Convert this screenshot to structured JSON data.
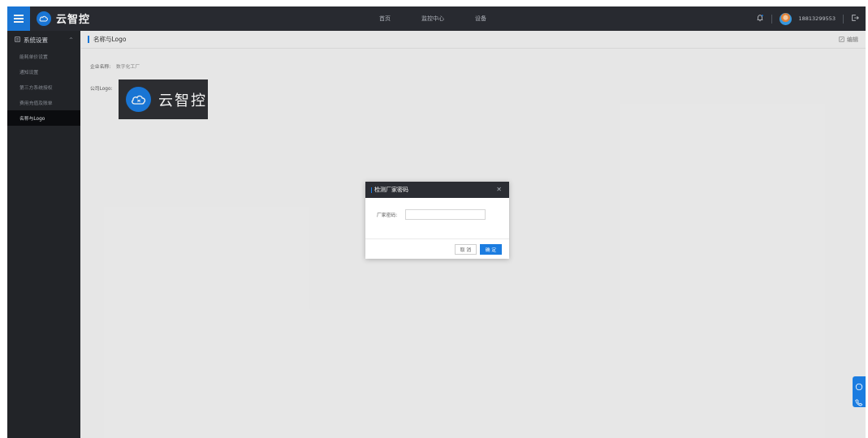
{
  "topbar": {
    "brand_name": "云智控",
    "nav": [
      "首页",
      "监控中心",
      "设备"
    ],
    "phone": "18813299553",
    "accent": "#1b7ce0"
  },
  "sidebar": {
    "section_title": "系统设置",
    "items": [
      {
        "label": "能耗单价设置",
        "active": false
      },
      {
        "label": "通知设置",
        "active": false
      },
      {
        "label": "第三方系统授权",
        "active": false
      },
      {
        "label": "费用充值及账单",
        "active": false
      },
      {
        "label": "名称与Logo",
        "active": true
      }
    ]
  },
  "content": {
    "title": "名称与Logo",
    "edit_label": "编辑",
    "company_label": "企业名称:",
    "company_value": "数字化工厂",
    "logo_label": "公司Logo:",
    "logo_text": "云智控"
  },
  "dialog": {
    "title": "检测厂家密码",
    "field_label": "厂家密码:",
    "field_value": "",
    "cancel_label": "取 消",
    "ok_label": "确 定"
  },
  "icons": [
    "menu-icon",
    "cloud-icon",
    "bell-icon",
    "logout-icon",
    "grid-icon",
    "edit-icon",
    "chat-icon",
    "phone-icon",
    "close-icon"
  ]
}
